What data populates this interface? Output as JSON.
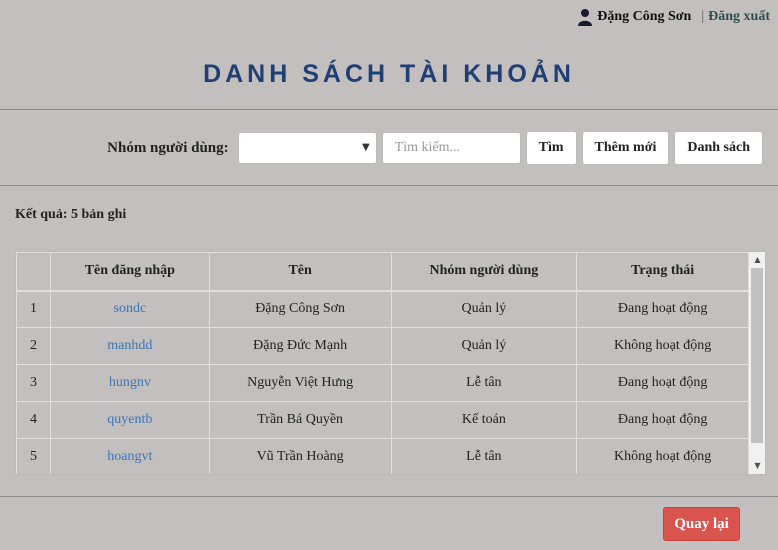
{
  "header": {
    "user_icon": "user-icon",
    "user_name": "Đặng Công Sơn",
    "separator": "|",
    "logout_label": "Đăng xuất"
  },
  "title": "DANH SÁCH TÀI KHOẢN",
  "filter": {
    "group_label": "Nhóm người dùng:",
    "group_selected": "",
    "search_placeholder": "Tìm kiếm...",
    "search_value": "",
    "search_button": "Tìm",
    "add_button": "Thêm mới",
    "list_button": "Danh sách"
  },
  "result_text": "Kết quả: 5 bản ghi",
  "table": {
    "headers": [
      "",
      "Tên đăng nhập",
      "Tên",
      "Nhóm người dùng",
      "Trạng thái"
    ],
    "rows": [
      {
        "idx": "1",
        "login": "sondc",
        "name": "Đặng Công Sơn",
        "group": "Quản lý",
        "status": "Đang hoạt động"
      },
      {
        "idx": "2",
        "login": "manhdd",
        "name": "Đặng Đức Mạnh",
        "group": "Quản lý",
        "status": "Không hoạt động"
      },
      {
        "idx": "3",
        "login": "hungnv",
        "name": "Nguyễn Việt Hưng",
        "group": "Lễ tân",
        "status": "Đang hoạt động"
      },
      {
        "idx": "4",
        "login": "quyentb",
        "name": "Trần Bá Quyền",
        "group": "Kế toán",
        "status": "Đang hoạt động"
      },
      {
        "idx": "5",
        "login": "hoangvt",
        "name": "Vũ Trần Hoàng",
        "group": "Lễ tân",
        "status": "Không hoạt động"
      }
    ]
  },
  "back_button": "Quay lại",
  "colors": {
    "background": "#c3bfbf",
    "title": "#1f3f75",
    "link": "#3a77b7",
    "back_button": "#d9534f"
  }
}
